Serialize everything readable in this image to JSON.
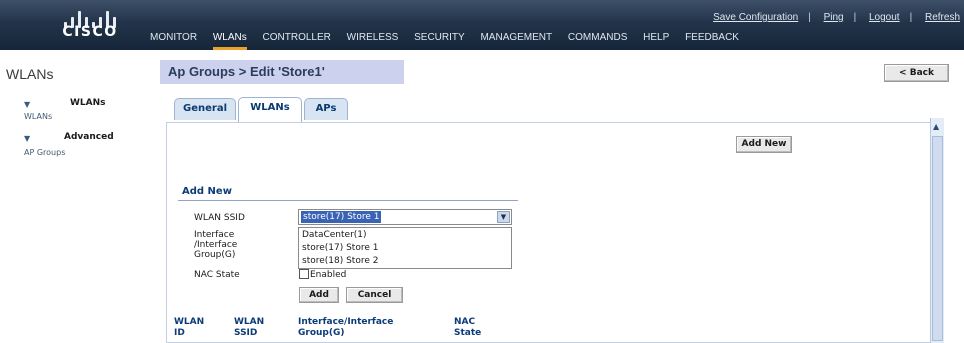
{
  "header": {
    "brand": "CISCO",
    "top_links": [
      "Save Configuration",
      "Ping",
      "Logout",
      "Refresh"
    ],
    "nav": [
      "MONITOR",
      "WLANs",
      "CONTROLLER",
      "WIRELESS",
      "SECURITY",
      "MANAGEMENT",
      "COMMANDS",
      "HELP",
      "FEEDBACK"
    ],
    "active_nav": "WLANs",
    "accent_color": "#e9a12c"
  },
  "sidebar": {
    "title": "WLANs",
    "groups": [
      {
        "label": "WLANs",
        "sub": "WLANs",
        "icon": "triangle-down-icon"
      },
      {
        "label": "Advanced",
        "sub": "AP Groups",
        "icon": "triangle-down-icon"
      }
    ]
  },
  "main": {
    "title": "Ap Groups > Edit  'Store1'",
    "back_label": "< Back",
    "tabs": [
      "General",
      "WLANs",
      "APs"
    ],
    "active_tab": "WLANs",
    "add_new_top": "Add New",
    "section_title": "Add New",
    "form": {
      "wlan_ssid_label": "WLAN SSID",
      "interface_label": "Interface /Interface Group(G)",
      "nac_state_label": "NAC State",
      "selected_value": "store(17) Store 1",
      "options": [
        "DataCenter(1)",
        "store(17) Store 1",
        "store(18) Store 2"
      ],
      "enabled_label": "Enabled",
      "enabled_checked": false,
      "add_label": "Add",
      "cancel_label": "Cancel"
    },
    "table_headers": [
      "WLAN ID",
      "WLAN SSID",
      "Interface/Interface Group(G)",
      "NAC State"
    ]
  }
}
